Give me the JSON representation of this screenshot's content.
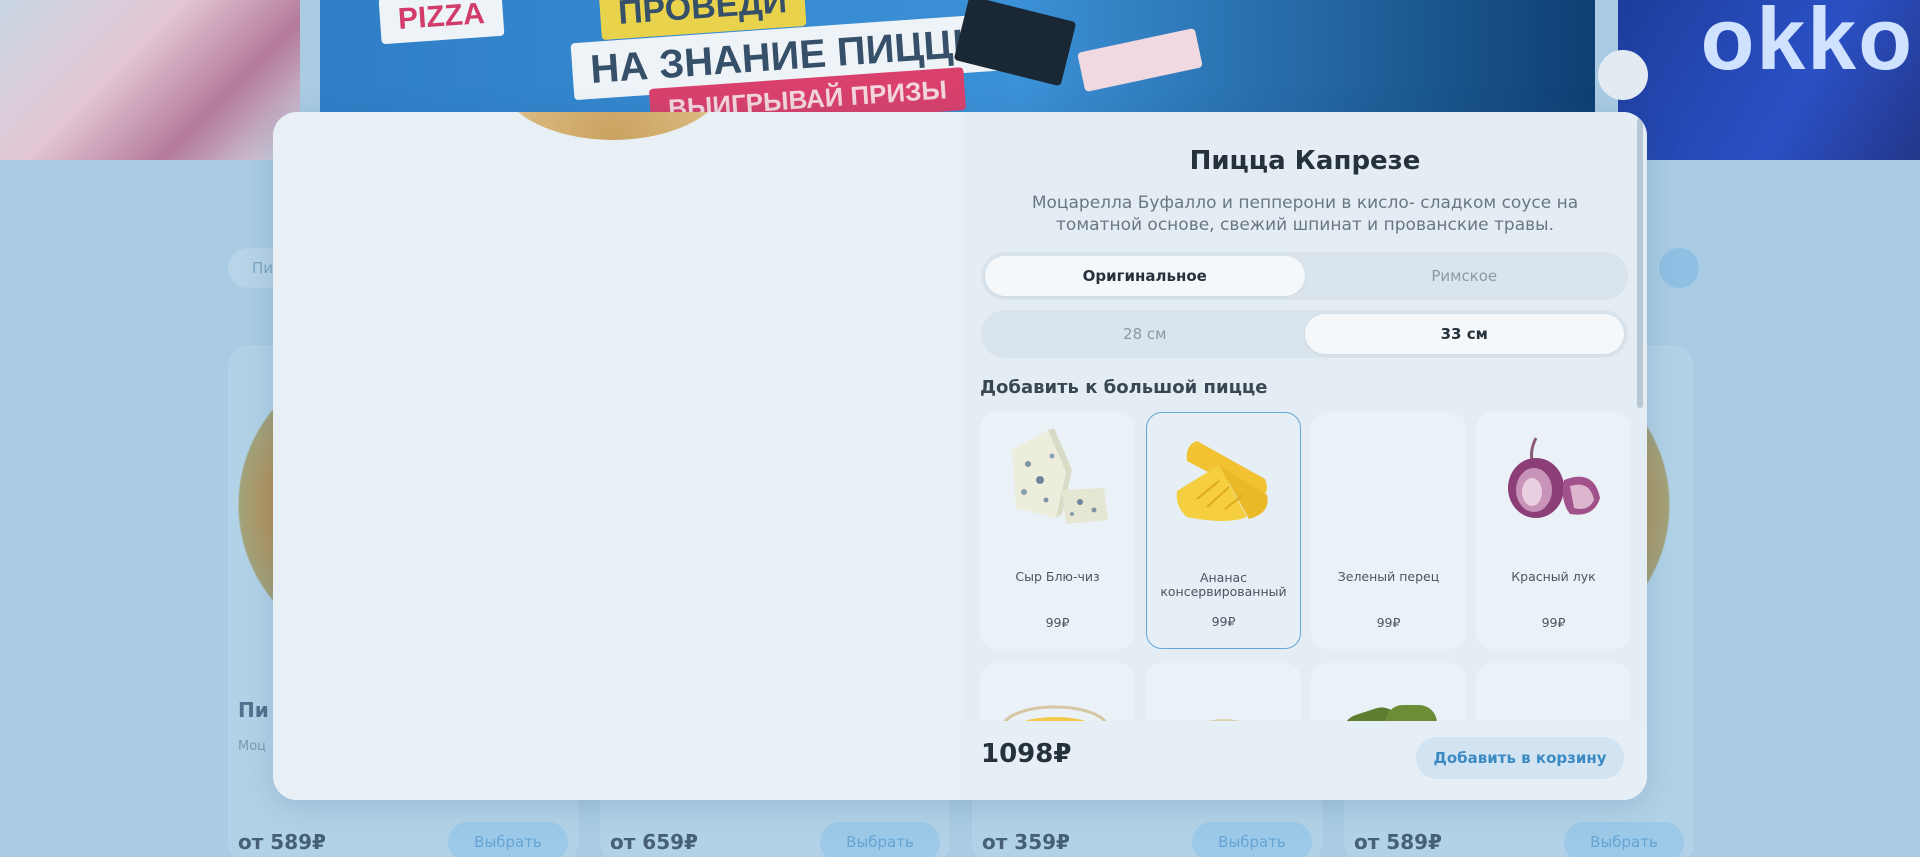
{
  "background": {
    "banner": {
      "brand_word": "PIZZA",
      "headline": "НА ЗНАНИЕ ПИЦЦЫ",
      "top_strip": "ПРОВЕДИ",
      "sub_strip": "ВЫИГРЫВАЙ ПРИЗЫ",
      "right_logo": "okko"
    },
    "category_pill": "Пи",
    "cards": [
      {
        "title": "Пи",
        "desc": "Моц",
        "price": "от 589₽",
        "button": "Выбрать"
      },
      {
        "title": "",
        "desc": "",
        "price": "от 659₽",
        "button": "Выбрать"
      },
      {
        "title": "",
        "desc": "",
        "price": "от 359₽",
        "button": "Выбрать"
      },
      {
        "title": "",
        "desc": "",
        "price": "от 589₽",
        "button": "Выбрать"
      }
    ]
  },
  "product": {
    "title": "Пицца Капрезе",
    "description": "Моцарелла Буфалло и пепперони в кисло- сладком соусе на томатной основе, свежий шпинат и прованские травы.",
    "dough_options": [
      {
        "label": "Оригинальное",
        "selected": true
      },
      {
        "label": "Римское",
        "selected": false
      }
    ],
    "size_options": [
      {
        "label": "28 см",
        "selected": false
      },
      {
        "label": "33 см",
        "selected": true
      }
    ],
    "addons_title": "Добавить к большой пицце",
    "addons": [
      {
        "name": "Сыр Блю-чиз",
        "price": "99₽",
        "icon": "blue-cheese",
        "selected": false
      },
      {
        "name": "Ананас консервированный",
        "price": "99₽",
        "icon": "pineapple",
        "selected": true
      },
      {
        "name": "Зеленый перец",
        "price": "99₽",
        "icon": "green-pepper",
        "selected": false
      },
      {
        "name": "Красный лук",
        "price": "99₽",
        "icon": "red-onion",
        "selected": false
      }
    ],
    "addons_row2_icons": [
      "corn",
      "parmesan",
      "pickles",
      "carrot"
    ],
    "total": "1098₽",
    "add_to_cart": "Добавить в корзину"
  },
  "colors": {
    "accent": "#3b8ac3",
    "overlay": "#a9cbe3",
    "modal": "#e6eff6"
  }
}
